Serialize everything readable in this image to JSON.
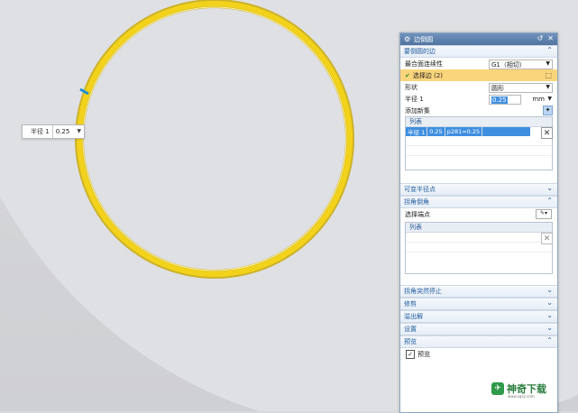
{
  "tooltip": {
    "label": "半径 1",
    "value": "0.25"
  },
  "dialog": {
    "title": "边倒圆",
    "sections": {
      "edges": "要倒圆的边",
      "variable_radius": "可变半径点",
      "corner_setback": "拐角倒角",
      "corner_stop": "拐角突然停止",
      "trim": "修剪",
      "overflow": "溢出解",
      "settings": "设置",
      "preview": "预览"
    },
    "edges": {
      "continuity_label": "最合面连续性",
      "continuity_value": "G1（相切）",
      "select_edge": "选择边 (2)",
      "shape_label": "形状",
      "shape_value": "圆形",
      "radius_label": "半径 1",
      "radius_value": "0.25",
      "radius_unit": "mm",
      "add_set": "添加新集",
      "list_header": "列表",
      "list_row": [
        "半径 1",
        "0.25",
        "p281=0.25"
      ]
    },
    "corner": {
      "select_point": "选择端点",
      "list_header": "列表"
    },
    "preview": {
      "checkbox": "预览",
      "checked": true
    }
  },
  "watermark": {
    "title": "神奇下载",
    "sub": "www.sqxz.com"
  },
  "colors": {
    "ring": "#f2d21a",
    "accent": "#3f8fe0",
    "title_bar": "#5a7fae"
  }
}
